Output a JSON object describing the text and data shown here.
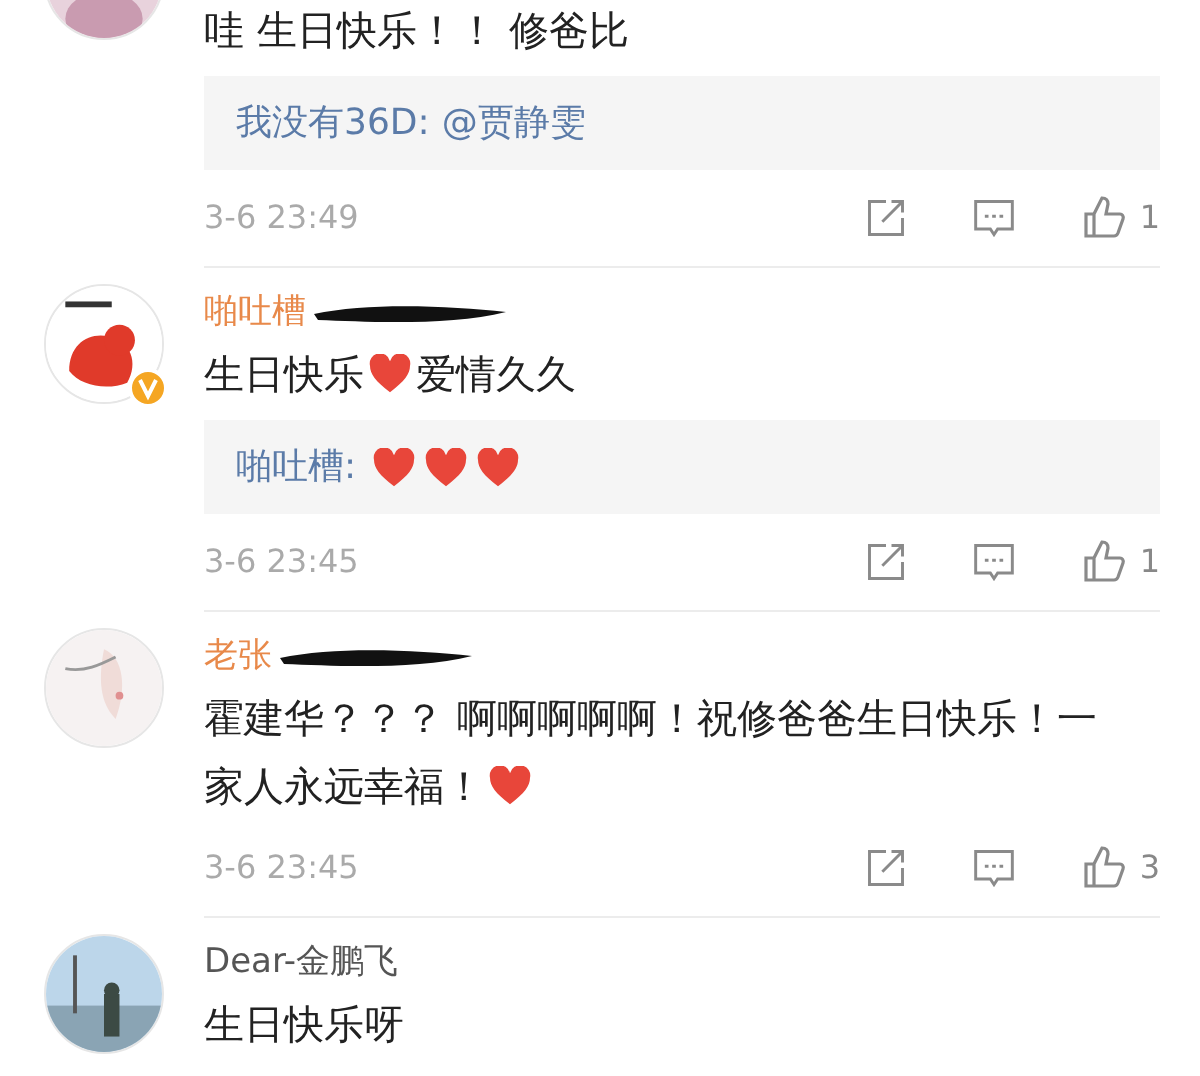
{
  "comments": [
    {
      "body": [
        {
          "kind": "text",
          "text": "哇 生日快乐！！ 修爸比"
        }
      ],
      "reply": {
        "author": "我没有36D:",
        "body": [
          {
            "kind": "text",
            "text": "@贾静雯"
          }
        ]
      },
      "time": "3-6 23:49",
      "likes": "1"
    },
    {
      "author": "啪吐槽",
      "redacted": true,
      "verified": true,
      "body": [
        {
          "kind": "text",
          "text": "生日快乐"
        },
        {
          "kind": "heart"
        },
        {
          "kind": "text",
          "text": "爱情久久"
        }
      ],
      "reply": {
        "author": "啪吐槽:",
        "body": [
          {
            "kind": "heart"
          },
          {
            "kind": "heart"
          },
          {
            "kind": "heart"
          }
        ]
      },
      "time": "3-6 23:45",
      "likes": "1"
    },
    {
      "author": "老张",
      "redacted": true,
      "verified": false,
      "body": [
        {
          "kind": "text",
          "text": "霍建华？？？ 啊啊啊啊啊！祝修爸爸生日快乐！一"
        },
        {
          "kind": "text",
          "text": "家人永远幸福！"
        },
        {
          "kind": "heart"
        }
      ],
      "time": "3-6 23:45",
      "likes": "3"
    },
    {
      "author": "Dear-金鹏飞",
      "redacted": false,
      "verified": false,
      "body": [
        {
          "kind": "text",
          "text": "生日快乐呀"
        }
      ]
    }
  ]
}
